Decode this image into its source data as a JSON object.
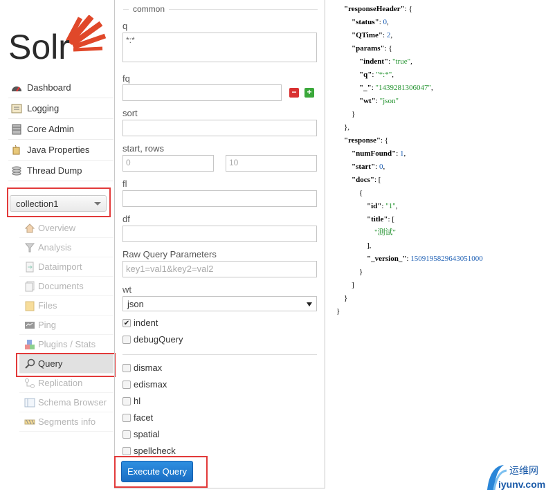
{
  "sidebar": {
    "logo_text": "Solr",
    "menu": [
      {
        "label": "Dashboard",
        "icon": "dashboard-icon"
      },
      {
        "label": "Logging",
        "icon": "logging-icon"
      },
      {
        "label": "Core Admin",
        "icon": "core-admin-icon"
      },
      {
        "label": "Java Properties",
        "icon": "java-properties-icon"
      },
      {
        "label": "Thread Dump",
        "icon": "thread-dump-icon"
      }
    ],
    "core_selector": {
      "value": "collection1"
    },
    "core_menu": [
      {
        "label": "Overview",
        "icon": "home-icon"
      },
      {
        "label": "Analysis",
        "icon": "funnel-icon"
      },
      {
        "label": "Dataimport",
        "icon": "dataimport-icon"
      },
      {
        "label": "Documents",
        "icon": "documents-icon"
      },
      {
        "label": "Files",
        "icon": "folder-icon"
      },
      {
        "label": "Ping",
        "icon": "ping-icon"
      },
      {
        "label": "Plugins / Stats",
        "icon": "plugins-icon"
      },
      {
        "label": "Query",
        "icon": "magnifier-icon",
        "active": true
      },
      {
        "label": "Replication",
        "icon": "replication-icon"
      },
      {
        "label": "Schema Browser",
        "icon": "schema-icon"
      },
      {
        "label": "Segments info",
        "icon": "segments-icon"
      }
    ]
  },
  "form": {
    "legend": "common",
    "q": {
      "label": "q",
      "value": "*:*"
    },
    "fq": {
      "label": "fq",
      "value": ""
    },
    "sort": {
      "label": "sort",
      "value": ""
    },
    "start_rows": {
      "label": "start, rows",
      "start_placeholder": "0",
      "rows_placeholder": "10"
    },
    "fl": {
      "label": "fl",
      "value": ""
    },
    "df": {
      "label": "df",
      "value": ""
    },
    "raw": {
      "label": "Raw Query Parameters",
      "placeholder": "key1=val1&key2=val2"
    },
    "wt": {
      "label": "wt",
      "value": "json"
    },
    "checks": [
      {
        "label": "indent",
        "checked": true
      },
      {
        "label": "debugQuery",
        "checked": false
      }
    ],
    "options": [
      {
        "label": "dismax",
        "checked": false
      },
      {
        "label": "edismax",
        "checked": false
      },
      {
        "label": "hl",
        "checked": false
      },
      {
        "label": "facet",
        "checked": false
      },
      {
        "label": "spatial",
        "checked": false
      },
      {
        "label": "spellcheck",
        "checked": false
      }
    ],
    "execute_label": "Execute Query"
  },
  "response": {
    "lines": [
      {
        "indent": 1,
        "parts": [
          {
            "t": "key",
            "v": "\"responseHeader\""
          },
          {
            "t": "pun",
            "v": ": {"
          }
        ]
      },
      {
        "indent": 2,
        "parts": [
          {
            "t": "key",
            "v": "\"status\""
          },
          {
            "t": "pun",
            "v": ": "
          },
          {
            "t": "num",
            "v": "0"
          },
          {
            "t": "pun",
            "v": ","
          }
        ]
      },
      {
        "indent": 2,
        "parts": [
          {
            "t": "key",
            "v": "\"QTime\""
          },
          {
            "t": "pun",
            "v": ": "
          },
          {
            "t": "num",
            "v": "2"
          },
          {
            "t": "pun",
            "v": ","
          }
        ]
      },
      {
        "indent": 2,
        "parts": [
          {
            "t": "key",
            "v": "\"params\""
          },
          {
            "t": "pun",
            "v": ": {"
          }
        ]
      },
      {
        "indent": 3,
        "parts": [
          {
            "t": "key",
            "v": "\"indent\""
          },
          {
            "t": "pun",
            "v": ": "
          },
          {
            "t": "str",
            "v": "\"true\""
          },
          {
            "t": "pun",
            "v": ","
          }
        ]
      },
      {
        "indent": 3,
        "parts": [
          {
            "t": "key",
            "v": "\"q\""
          },
          {
            "t": "pun",
            "v": ": "
          },
          {
            "t": "str",
            "v": "\"*:*\""
          },
          {
            "t": "pun",
            "v": ","
          }
        ]
      },
      {
        "indent": 3,
        "parts": [
          {
            "t": "key",
            "v": "\"_\""
          },
          {
            "t": "pun",
            "v": ": "
          },
          {
            "t": "str",
            "v": "\"1439281306047\""
          },
          {
            "t": "pun",
            "v": ","
          }
        ]
      },
      {
        "indent": 3,
        "parts": [
          {
            "t": "key",
            "v": "\"wt\""
          },
          {
            "t": "pun",
            "v": ": "
          },
          {
            "t": "str",
            "v": "\"json\""
          }
        ]
      },
      {
        "indent": 2,
        "parts": [
          {
            "t": "pun",
            "v": "}"
          }
        ]
      },
      {
        "indent": 1,
        "parts": [
          {
            "t": "pun",
            "v": "},"
          }
        ]
      },
      {
        "indent": 1,
        "parts": [
          {
            "t": "key",
            "v": "\"response\""
          },
          {
            "t": "pun",
            "v": ": {"
          }
        ]
      },
      {
        "indent": 2,
        "parts": [
          {
            "t": "key",
            "v": "\"numFound\""
          },
          {
            "t": "pun",
            "v": ": "
          },
          {
            "t": "num",
            "v": "1"
          },
          {
            "t": "pun",
            "v": ","
          }
        ]
      },
      {
        "indent": 2,
        "parts": [
          {
            "t": "key",
            "v": "\"start\""
          },
          {
            "t": "pun",
            "v": ": "
          },
          {
            "t": "num",
            "v": "0"
          },
          {
            "t": "pun",
            "v": ","
          }
        ]
      },
      {
        "indent": 2,
        "parts": [
          {
            "t": "key",
            "v": "\"docs\""
          },
          {
            "t": "pun",
            "v": ": ["
          }
        ]
      },
      {
        "indent": 3,
        "parts": [
          {
            "t": "pun",
            "v": "{"
          }
        ]
      },
      {
        "indent": 4,
        "parts": [
          {
            "t": "key",
            "v": "\"id\""
          },
          {
            "t": "pun",
            "v": ": "
          },
          {
            "t": "str",
            "v": "\"1\""
          },
          {
            "t": "pun",
            "v": ","
          }
        ]
      },
      {
        "indent": 4,
        "parts": [
          {
            "t": "key",
            "v": "\"title\""
          },
          {
            "t": "pun",
            "v": ": ["
          }
        ]
      },
      {
        "indent": 5,
        "parts": [
          {
            "t": "str",
            "v": "\"测试\""
          }
        ]
      },
      {
        "indent": 4,
        "parts": [
          {
            "t": "pun",
            "v": "],"
          }
        ]
      },
      {
        "indent": 4,
        "parts": [
          {
            "t": "key",
            "v": "\"_version_\""
          },
          {
            "t": "pun",
            "v": ": "
          },
          {
            "t": "num",
            "v": "1509195829643051000"
          }
        ]
      },
      {
        "indent": 3,
        "parts": [
          {
            "t": "pun",
            "v": "}"
          }
        ]
      },
      {
        "indent": 2,
        "parts": [
          {
            "t": "pun",
            "v": "]"
          }
        ]
      },
      {
        "indent": 1,
        "parts": [
          {
            "t": "pun",
            "v": "}"
          }
        ]
      },
      {
        "indent": 0,
        "parts": [
          {
            "t": "pun",
            "v": "}"
          }
        ]
      }
    ]
  },
  "watermark": {
    "cn": "运维网",
    "en": "iyunv.com"
  },
  "colors": {
    "highlight": "#e23a3a",
    "button_blue": "#1a6ec4",
    "json_string": "#22922e",
    "json_number": "#1d5fb4",
    "logo_orange": "#e0482a"
  }
}
